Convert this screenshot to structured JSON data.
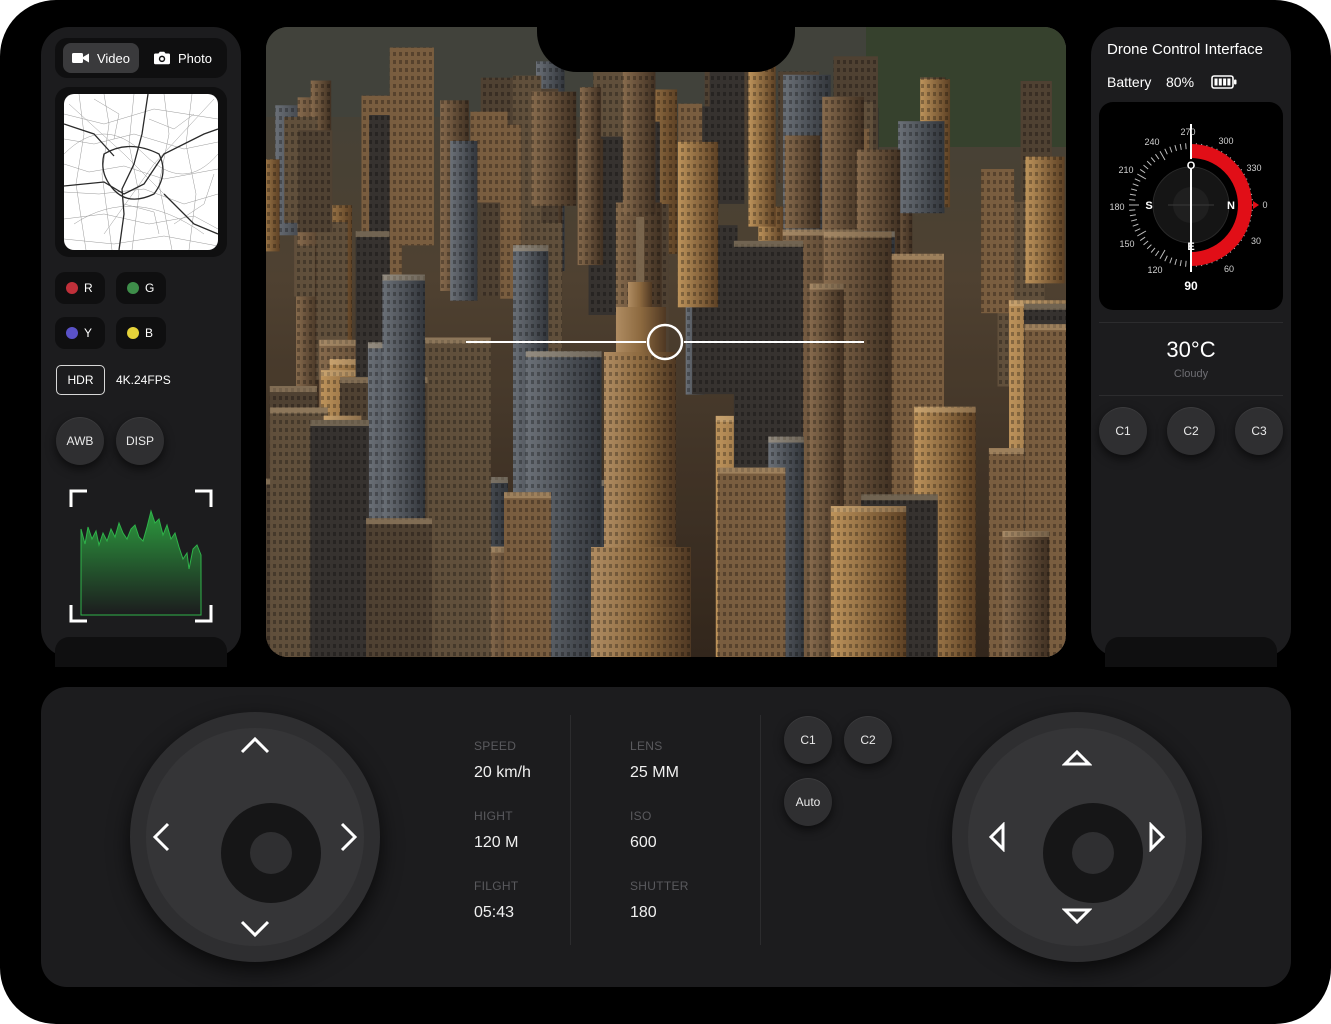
{
  "camera": {
    "video_label": "Video",
    "photo_label": "Photo"
  },
  "colors": [
    {
      "label": "R",
      "hex": "#c0303a"
    },
    {
      "label": "G",
      "hex": "#3e8e4a"
    },
    {
      "label": "Y",
      "hex": "#5a52c8"
    },
    {
      "label": "B",
      "hex": "#e6d33a"
    }
  ],
  "hdr_label": "HDR",
  "resolution": "4K.24FPS",
  "awb_label": "AWB",
  "disp_label": "DISP",
  "right": {
    "title": "Drone Control Interface",
    "battery_label": "Battery",
    "battery_value": "80%",
    "battery_level": 0.8,
    "compass": {
      "heading": "90",
      "ticks": [
        "240",
        "270",
        "300",
        "330",
        "0",
        "30",
        "60",
        "120",
        "150",
        "180",
        "210"
      ],
      "letters": [
        "O",
        "N",
        "E",
        "S"
      ]
    },
    "temperature": "30°C",
    "condition": "Cloudy",
    "buttons": [
      "C1",
      "C2",
      "C3"
    ]
  },
  "stats": {
    "speed_label": "SPEED",
    "speed_value": "20 km/h",
    "height_label": "HIGHT",
    "height_value": "120 M",
    "flight_label": "FILGHT",
    "flight_value": "05:43",
    "lens_label": "LENS",
    "lens_value": "25 MM",
    "iso_label": "ISO",
    "iso_value": "600",
    "shutter_label": "SHUTTER",
    "shutter_value": "180"
  },
  "bottom_buttons": [
    "C1",
    "C2",
    "Auto"
  ],
  "accent": "#e10e17"
}
